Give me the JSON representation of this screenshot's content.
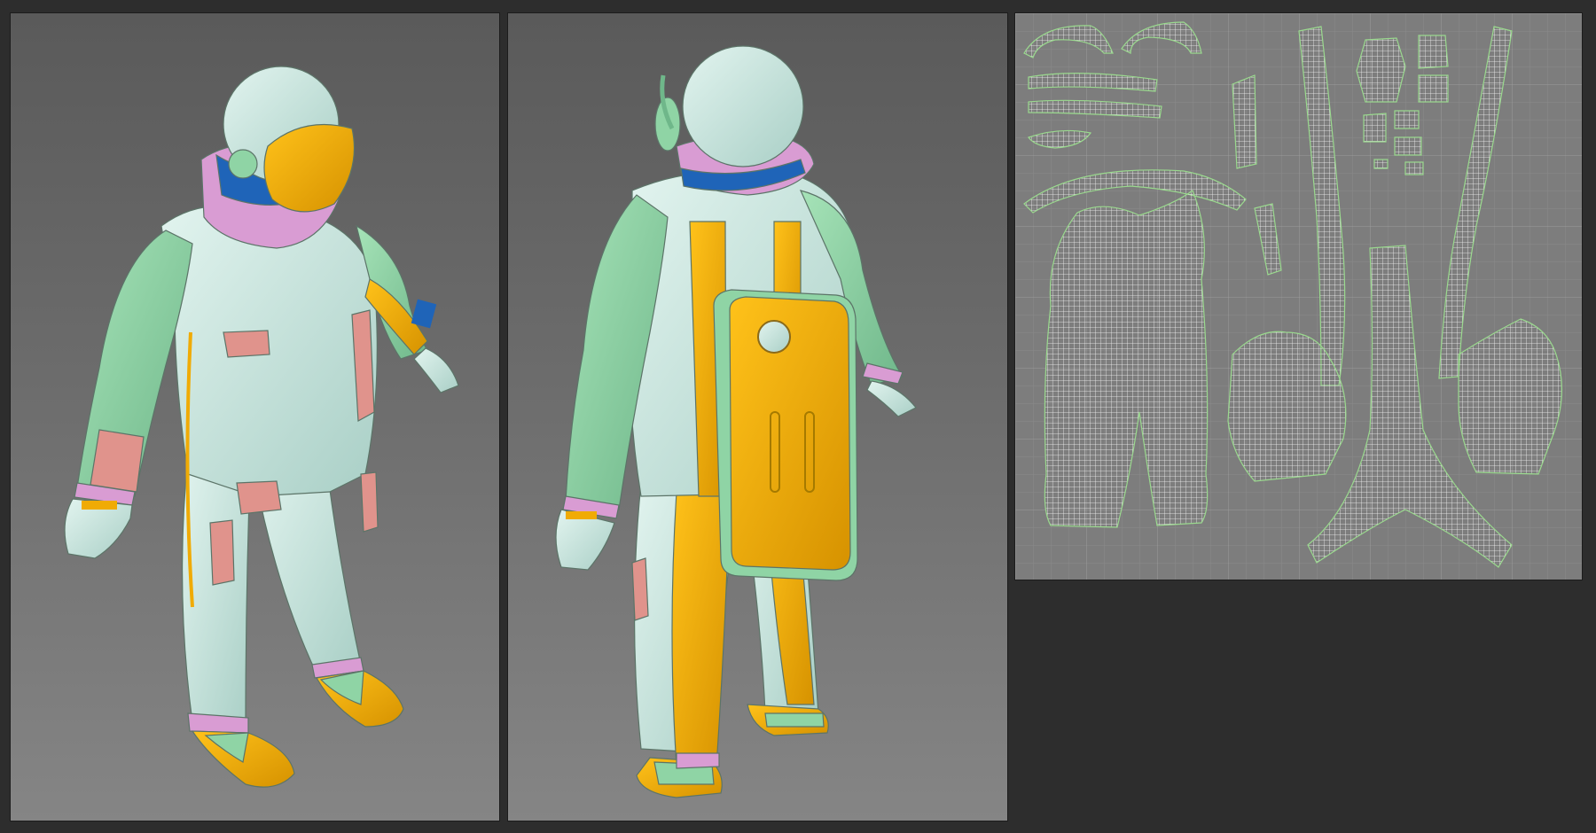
{
  "viewports": [
    {
      "id": "front",
      "description_hidden": ""
    },
    {
      "id": "back",
      "description_hidden": ""
    },
    {
      "id": "uv",
      "description_hidden": ""
    }
  ],
  "colors": {
    "background": "#2d2d2d",
    "viewport_gradient_top": "#5a5a5a",
    "viewport_gradient_bottom": "#858585",
    "uv_background": "#7d7d7d",
    "uv_grid_line": "#8e8e8e",
    "uv_grid_major": "#a5a5a5",
    "suit_white": "#cfe9e3",
    "suit_green": "#8fd4a5",
    "suit_yellow": "#f0ab05",
    "suit_pink": "#d99cd3",
    "suit_salmon": "#e0938c",
    "collar_blue": "#1f64b8",
    "uv_wire": "#f4f4f4",
    "uv_edge": "#9ad98e"
  },
  "icons": []
}
